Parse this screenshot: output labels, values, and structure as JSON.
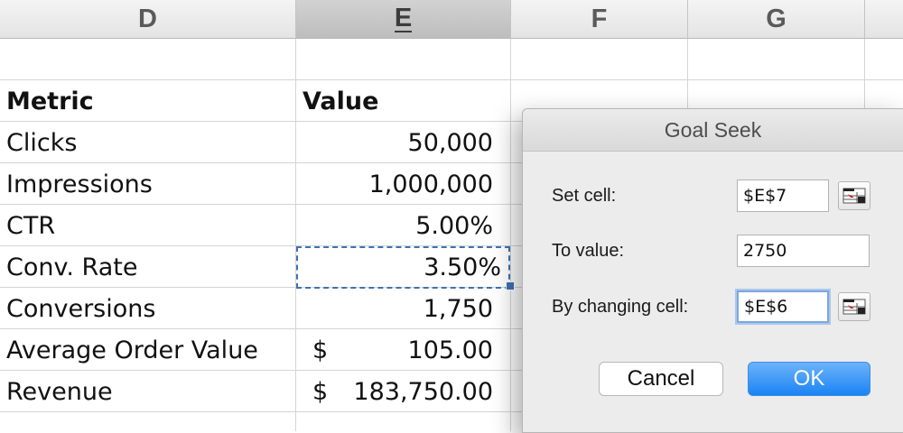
{
  "columns": [
    {
      "letter": "D",
      "selected": false
    },
    {
      "letter": "E",
      "selected": true
    },
    {
      "letter": "F",
      "selected": false
    },
    {
      "letter": "G",
      "selected": false
    }
  ],
  "table": {
    "header": {
      "metric": "Metric",
      "value": "Value"
    },
    "rows": [
      {
        "metric": "Clicks",
        "value": "50,000"
      },
      {
        "metric": "Impressions",
        "value": "1,000,000"
      },
      {
        "metric": "CTR",
        "value": "5.00%"
      },
      {
        "metric": "Conv. Rate",
        "value": "3.50%"
      },
      {
        "metric": "Conversions",
        "value": "1,750"
      },
      {
        "metric": "Average Order Value",
        "currency": "$",
        "value": "105.00"
      },
      {
        "metric": "Revenue",
        "currency": "$",
        "value": "183,750.00"
      }
    ]
  },
  "goal_seek": {
    "title": "Goal Seek",
    "set_cell_label": "Set cell:",
    "set_cell_value": "$E$7",
    "to_value_label": "To value:",
    "to_value_value": "2750",
    "changing_cell_label": "By changing cell:",
    "changing_cell_value": "$E$6",
    "cancel_label": "Cancel",
    "ok_label": "OK"
  },
  "colors": {
    "selection": "#3f72b3",
    "ok_button": "#1b83f3"
  }
}
